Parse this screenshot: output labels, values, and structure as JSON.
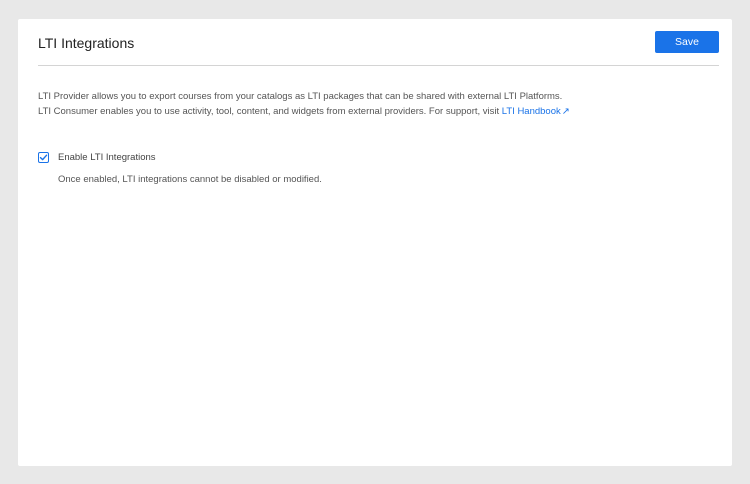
{
  "page": {
    "title": "LTI Integrations",
    "save_label": "Save"
  },
  "description": {
    "line1": "LTI Provider allows you to export courses from your catalogs as LTI packages that can be shared with external LTI Platforms.",
    "line2_prefix": "LTI Consumer enables you to use activity, tool, content, and widgets from external providers. For support, visit ",
    "link_label": "LTI Handbook",
    "link_icon": "external-link-icon"
  },
  "settings": {
    "enable_label": "Enable LTI Integrations",
    "enable_checked": true,
    "enable_hint": "Once enabled, LTI integrations cannot be disabled or modified."
  },
  "colors": {
    "accent": "#1a73e8",
    "background": "#e8e8e8",
    "card": "#ffffff"
  }
}
